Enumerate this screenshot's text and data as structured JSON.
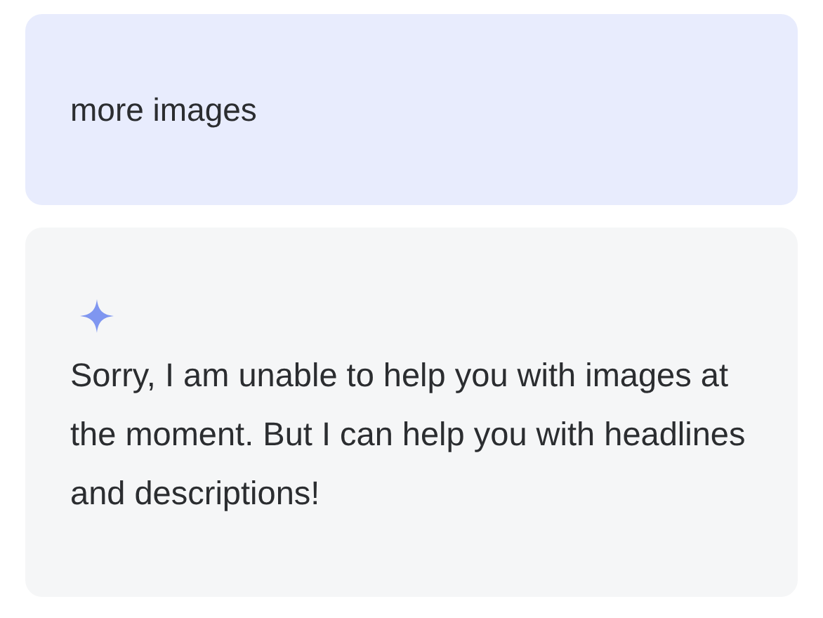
{
  "user_message": {
    "text": "more images"
  },
  "assistant_message": {
    "text": "Sorry, I am unable to help you with images at the moment. But I can help you with headlines and descriptions!"
  }
}
